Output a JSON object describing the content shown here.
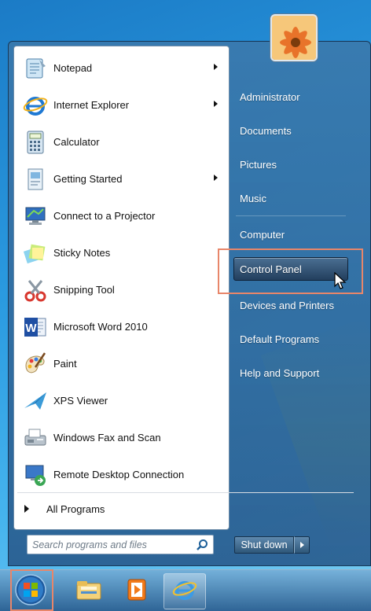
{
  "programs": [
    {
      "label": "Notepad",
      "icon": "notepad-icon",
      "has_submenu": true
    },
    {
      "label": "Internet Explorer",
      "icon": "internet-explorer-icon",
      "has_submenu": true
    },
    {
      "label": "Calculator",
      "icon": "calculator-icon",
      "has_submenu": false
    },
    {
      "label": "Getting Started",
      "icon": "getting-started-icon",
      "has_submenu": true
    },
    {
      "label": "Connect to a Projector",
      "icon": "projector-icon",
      "has_submenu": false
    },
    {
      "label": "Sticky Notes",
      "icon": "sticky-notes-icon",
      "has_submenu": false
    },
    {
      "label": "Snipping Tool",
      "icon": "snipping-tool-icon",
      "has_submenu": false
    },
    {
      "label": "Microsoft Word 2010",
      "icon": "word-icon",
      "has_submenu": false
    },
    {
      "label": "Paint",
      "icon": "paint-icon",
      "has_submenu": false
    },
    {
      "label": "XPS Viewer",
      "icon": "xps-viewer-icon",
      "has_submenu": false
    },
    {
      "label": "Windows Fax and Scan",
      "icon": "fax-scan-icon",
      "has_submenu": false
    },
    {
      "label": "Remote Desktop Connection",
      "icon": "remote-desktop-icon",
      "has_submenu": false
    }
  ],
  "all_programs_label": "All Programs",
  "search": {
    "placeholder": "Search programs and files"
  },
  "right_items": {
    "administrator": "Administrator",
    "documents": "Documents",
    "pictures": "Pictures",
    "music": "Music",
    "computer": "Computer",
    "control_panel": "Control Panel",
    "devices_printers": "Devices and Printers",
    "default_programs": "Default Programs",
    "help_support": "Help and Support"
  },
  "shutdown_label": "Shut down",
  "taskbar": [
    "start-orb-icon",
    "explorer-folder-icon",
    "media-player-icon",
    "internet-explorer-icon"
  ],
  "colors": {
    "highlight_box": "#e8866a",
    "menu_text": "#111111",
    "right_text": "#ffffff"
  }
}
